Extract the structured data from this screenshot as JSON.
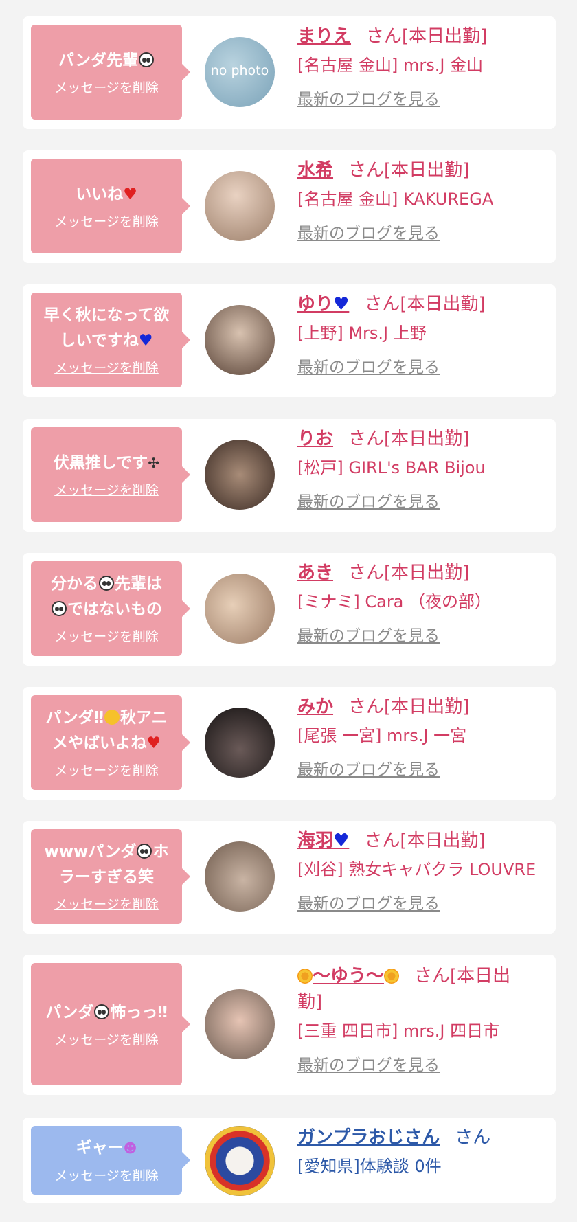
{
  "cards": [
    {
      "message": "パンダ先輩",
      "delete_label": "メッセージを削除",
      "name": "まりえ",
      "suffix": "さん[本日出勤]",
      "shop": "[名古屋 金山] mrs.J 金山",
      "blog_link": "最新のブログを見る",
      "avatar_text": "no photo"
    },
    {
      "message": "いいね",
      "delete_label": "メッセージを削除",
      "name": "水希",
      "suffix": "さん[本日出勤]",
      "shop": "[名古屋 金山] KAKUREGA",
      "blog_link": "最新のブログを見る"
    },
    {
      "message_line1": "早く秋になって欲",
      "message_line2": "しいですね",
      "delete_label": "メッセージを削除",
      "name": "ゆり",
      "suffix": "さん[本日出勤]",
      "shop": "[上野] Mrs.J 上野",
      "blog_link": "最新のブログを見る"
    },
    {
      "message": "伏黒推しです",
      "delete_label": "メッセージを削除",
      "name": "りお",
      "suffix": "さん[本日出勤]",
      "shop": "[松戸] GIRL's BAR Bijou",
      "blog_link": "最新のブログを見る"
    },
    {
      "message_line1_a": "分かる",
      "message_line1_b": "先輩は",
      "message_line2": "ではないもの",
      "delete_label": "メッセージを削除",
      "name": "あき",
      "suffix": "さん[本日出勤]",
      "shop": "[ミナミ] Cara （夜の部）",
      "blog_link": "最新のブログを見る"
    },
    {
      "message_line1_a": "パンダ‼",
      "message_line1_b": "秋アニ",
      "message_line2": "メやばいよね",
      "delete_label": "メッセージを削除",
      "name": "みか",
      "suffix": "さん[本日出勤]",
      "shop": "[尾張 一宮] mrs.J 一宮",
      "blog_link": "最新のブログを見る"
    },
    {
      "message_line1_a": "wwwパンダ",
      "message_line1_b": "ホ",
      "message_line2": "ラーすぎる笑",
      "delete_label": "メッセージを削除",
      "name": "海羽",
      "suffix": "さん[本日出勤]",
      "shop": "[刈谷] 熟女キャバクラ LOUVRE",
      "blog_link": "最新のブログを見る"
    },
    {
      "message_a": "パンダ",
      "message_b": "怖っっ‼",
      "delete_label": "メッセージを削除",
      "name": "〜ゆう〜",
      "suffix_line1": "さん[本日出",
      "suffix_line2": "勤]",
      "shop": "[三重 四日市] mrs.J 四日市",
      "blog_link": "最新のブログを見る"
    },
    {
      "message": "ギャー",
      "delete_label": "メッセージを削除",
      "name": "ガンプラおじさん",
      "suffix": "さん",
      "shop": "[愛知県]体験談 0件"
    }
  ],
  "icons": {
    "panda": "panda-face-icon",
    "heart": "heart-icon",
    "blue_heart": "blue-heart-icon",
    "paw": "paw-prints-icon",
    "laugh": "rolling-laughing-icon",
    "flower": "sunflower-icon",
    "scream": "screaming-face-icon"
  },
  "colors": {
    "bubble_pink": "#ee9ea8",
    "bubble_blue": "#9cb9ee",
    "cast_text": "#d23c63",
    "user_text": "#2d59a8",
    "link_gray": "#8a8a8a"
  }
}
